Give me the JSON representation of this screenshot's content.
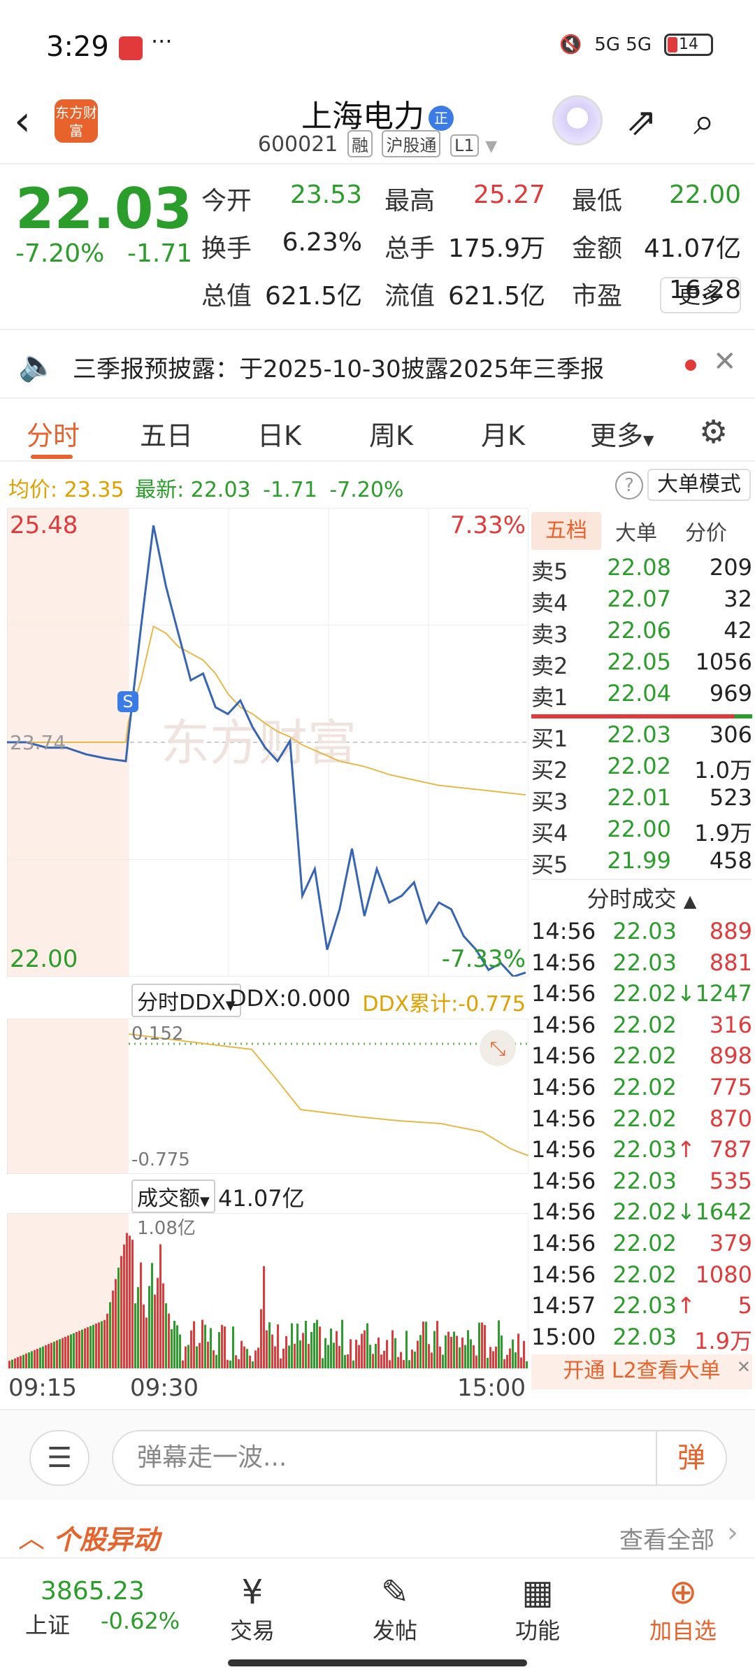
{
  "status_bar": {
    "time": "3:29",
    "dots": "···",
    "network": "5G 5G",
    "battery": "14"
  },
  "header": {
    "logo": "东方财富",
    "name": "上海电力",
    "name_tag": "正",
    "code": "600021",
    "badges": [
      "融",
      "沪股通",
      "L1"
    ]
  },
  "quote": {
    "price": "22.03",
    "change_pct": "-7.20%",
    "change": "-1.71",
    "fields": [
      {
        "label": "今开",
        "value": "23.53",
        "color": "#2a9d2a"
      },
      {
        "label": "最高",
        "value": "25.27",
        "color": "#e23a3a"
      },
      {
        "label": "最低",
        "value": "22.00",
        "color": "#2a9d2a"
      },
      {
        "label": "换手",
        "value": "6.23%",
        "color": "#222222"
      },
      {
        "label": "总手",
        "value": "175.9万",
        "color": "#222222"
      },
      {
        "label": "金额",
        "value": "41.07亿",
        "color": "#222222"
      },
      {
        "label": "总值",
        "value": "621.5亿",
        "color": "#222222"
      },
      {
        "label": "流值",
        "value": "621.5亿",
        "color": "#222222"
      },
      {
        "label": "市盈",
        "value": "16.28",
        "color": "#222222"
      }
    ],
    "more_label": "更多"
  },
  "notice": {
    "text": "三季报预披露：于2025-10-30披露2025年三季报"
  },
  "tabs": [
    "分时",
    "五日",
    "日K",
    "周K",
    "月K",
    "更多"
  ],
  "info_line": {
    "avg_label": "均价:",
    "avg_value": "23.35",
    "latest_label": "最新:",
    "latest_value": "22.03",
    "latest_change": "-1.71",
    "latest_pct": "-7.20%",
    "mode_label": "大单模式"
  },
  "main_chart": {
    "y_top": "25.48",
    "y_top_pct": "7.33%",
    "y_mid": "23.74",
    "y_bottom": "22.00",
    "y_bottom_pct": "-7.33%",
    "marker": "S",
    "watermark": "东方财富"
  },
  "ddx": {
    "selector": "分时DDX",
    "value_label": "DDX:0.000",
    "cum_label": "DDX累计:-0.775",
    "y_top": "0.152",
    "y_bottom": "-0.775"
  },
  "volume": {
    "selector": "成交额",
    "total": "41.07亿",
    "y_top": "1.08亿"
  },
  "time_axis": [
    "09:15",
    "09:30",
    "15:00"
  ],
  "order_book": {
    "tabs": [
      "五档",
      "大单",
      "分价"
    ],
    "asks": [
      {
        "label": "卖5",
        "price": "22.08",
        "vol": "209"
      },
      {
        "label": "卖4",
        "price": "22.07",
        "vol": "32"
      },
      {
        "label": "卖3",
        "price": "22.06",
        "vol": "42"
      },
      {
        "label": "卖2",
        "price": "22.05",
        "vol": "1056"
      },
      {
        "label": "卖1",
        "price": "22.04",
        "vol": "969"
      }
    ],
    "bids": [
      {
        "label": "买1",
        "price": "22.03",
        "vol": "306"
      },
      {
        "label": "买2",
        "price": "22.02",
        "vol": "1.0万"
      },
      {
        "label": "买3",
        "price": "22.01",
        "vol": "523"
      },
      {
        "label": "买4",
        "price": "22.00",
        "vol": "1.9万"
      },
      {
        "label": "买5",
        "price": "21.99",
        "vol": "458"
      }
    ],
    "ticks_title": "分时成交",
    "ticks": [
      {
        "time": "14:56",
        "price": "22.03",
        "arrow": "",
        "vol": "889",
        "color": "#e23a3a"
      },
      {
        "time": "14:56",
        "price": "22.03",
        "arrow": "",
        "vol": "881",
        "color": "#e23a3a"
      },
      {
        "time": "14:56",
        "price": "22.02",
        "arrow": "↓",
        "vol": "1247",
        "color": "#2a9d2a"
      },
      {
        "time": "14:56",
        "price": "22.02",
        "arrow": "",
        "vol": "316",
        "color": "#e23a3a"
      },
      {
        "time": "14:56",
        "price": "22.02",
        "arrow": "",
        "vol": "898",
        "color": "#e23a3a"
      },
      {
        "time": "14:56",
        "price": "22.02",
        "arrow": "",
        "vol": "775",
        "color": "#e23a3a"
      },
      {
        "time": "14:56",
        "price": "22.02",
        "arrow": "",
        "vol": "870",
        "color": "#e23a3a"
      },
      {
        "time": "14:56",
        "price": "22.03",
        "arrow": "↑",
        "vol": "787",
        "color": "#e23a3a"
      },
      {
        "time": "14:56",
        "price": "22.03",
        "arrow": "",
        "vol": "535",
        "color": "#e23a3a"
      },
      {
        "time": "14:56",
        "price": "22.02",
        "arrow": "↓",
        "vol": "1642",
        "color": "#2a9d2a"
      },
      {
        "time": "14:56",
        "price": "22.02",
        "arrow": "",
        "vol": "379",
        "color": "#e23a3a"
      },
      {
        "time": "14:56",
        "price": "22.02",
        "arrow": "",
        "vol": "1080",
        "color": "#e23a3a"
      },
      {
        "time": "14:57",
        "price": "22.03",
        "arrow": "↑",
        "vol": "5",
        "color": "#e23a3a"
      },
      {
        "time": "15:00",
        "price": "22.03",
        "arrow": "",
        "vol": "1.9万",
        "color": "#e23a3a"
      }
    ],
    "l2_promo": "开通 L2查看大单"
  },
  "danmu": {
    "placeholder": "弹幕走一波...",
    "send": "弹"
  },
  "movement": {
    "title": "个股异动",
    "link": "查看全部"
  },
  "bottom_nav": {
    "index_value": "3865.23",
    "index_name": "上证",
    "index_change": "-0.62%",
    "items": [
      {
        "label": "交易",
        "icon": "¥"
      },
      {
        "label": "发帖",
        "icon": "✎"
      },
      {
        "label": "功能",
        "icon": "▦"
      },
      {
        "label": "加自选",
        "icon": "⊕"
      }
    ]
  },
  "chart_data": {
    "type": "line",
    "x_ticks": [
      "09:15",
      "09:30",
      "15:00"
    ],
    "ylim": [
      22.0,
      25.48
    ],
    "y_ticks": [
      "25.48",
      "23.74",
      "22.00"
    ],
    "series": [
      {
        "values": [
          23.74,
          23.74,
          23.7,
          23.7,
          23.65,
          23.62,
          23.6,
          23.8,
          24.6,
          25.35,
          24.9,
          24.55,
          24.2,
          24.25,
          24.0,
          23.95,
          24.05,
          23.85,
          23.7,
          23.6,
          23.75,
          22.6,
          22.8,
          22.2,
          22.5,
          22.95,
          22.45,
          22.8,
          22.55,
          22.6,
          22.7,
          22.4,
          22.55,
          22.5,
          22.3,
          22.2,
          22.05,
          22.1,
          22.0,
          22.03
        ]
      },
      {
        "values": [
          23.74,
          23.74,
          23.74,
          23.74,
          23.74,
          23.74,
          23.74,
          23.9,
          24.2,
          24.6,
          24.55,
          24.45,
          24.4,
          24.35,
          24.25,
          24.1,
          24.0,
          23.95,
          23.88,
          23.82,
          23.78,
          23.72,
          23.68,
          23.64,
          23.6,
          23.58,
          23.56,
          23.53,
          23.5,
          23.48,
          23.46,
          23.44,
          23.42,
          23.41,
          23.4,
          23.39,
          23.38,
          23.37,
          23.36,
          23.35
        ]
      }
    ]
  }
}
